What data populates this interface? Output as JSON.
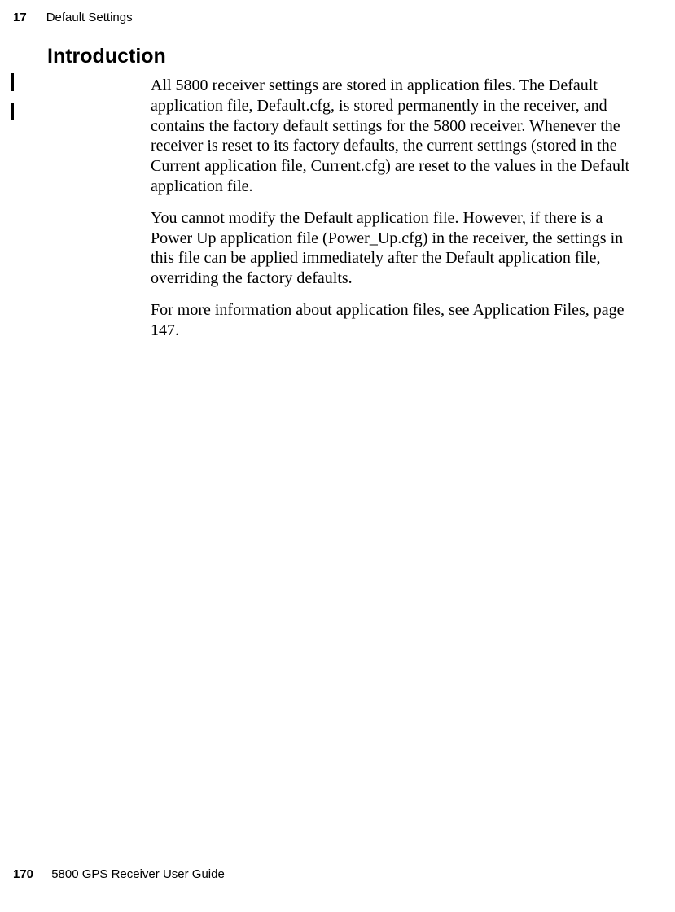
{
  "header": {
    "chapter_number": "17",
    "chapter_title": "Default Settings"
  },
  "section": {
    "heading": "Introduction"
  },
  "body": {
    "para1": "All 5800 receiver settings are stored in application files. The Default application file, Default.cfg, is stored permanently in the receiver, and contains the factory default settings for the 5800 receiver. Whenever the receiver is reset to its factory defaults, the current settings (stored in the Current application file, Current.cfg) are reset to the values in the Default application file.",
    "para2": "You cannot modify the Default application file. However, if there is a Power Up application file (Power_Up.cfg) in the receiver, the settings in this file can be applied immediately after the Default application file, overriding the factory defaults.",
    "para3": "For more information about application files, see Application Files, page 147."
  },
  "footer": {
    "page_number": "170",
    "doc_title": "5800 GPS Receiver User Guide"
  }
}
